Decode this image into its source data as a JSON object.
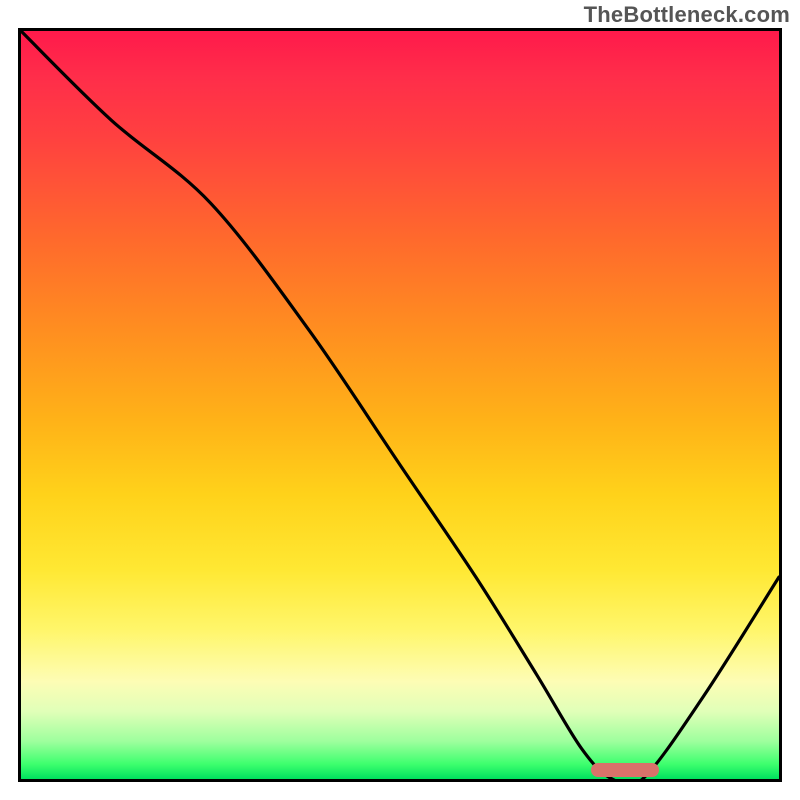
{
  "watermark": "TheBottleneck.com",
  "colors": {
    "gradient_top": "#ff1a4b",
    "gradient_mid_orange": "#ff8e20",
    "gradient_mid_yellow": "#ffe833",
    "gradient_bottom": "#00e05e",
    "curve": "#000000",
    "optimum_marker": "#d9726a",
    "frame_border": "#000000"
  },
  "chart_data": {
    "type": "line",
    "title": "",
    "xlabel": "",
    "ylabel": "",
    "xlim": [
      0,
      100
    ],
    "ylim": [
      0,
      100
    ],
    "grid": false,
    "legend": false,
    "series": [
      {
        "name": "bottleneck_curve",
        "x": [
          0,
          12,
          25,
          38,
          50,
          60,
          68,
          74,
          78,
          82,
          90,
          100
        ],
        "values": [
          100,
          88,
          77,
          60,
          42,
          27,
          14,
          4,
          0,
          0,
          11,
          27
        ]
      }
    ],
    "optimum_range_x": [
      75,
      84
    ]
  }
}
